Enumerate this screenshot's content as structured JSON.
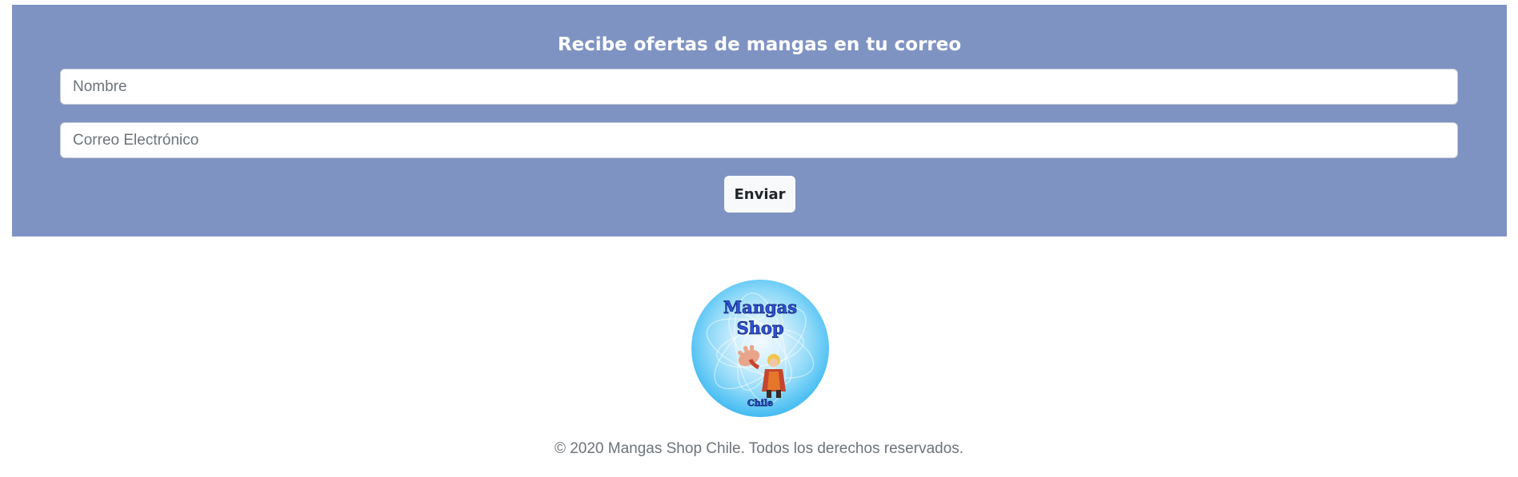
{
  "newsletter": {
    "title": "Recibe ofertas de mangas en tu correo",
    "name_placeholder": "Nombre",
    "email_placeholder": "Correo Electrónico",
    "submit_label": "Enviar",
    "background_color": "#7f93c3"
  },
  "footer": {
    "logo": {
      "line1": "Mangas",
      "line2": "Shop",
      "line3": "Chile"
    },
    "copyright": "© 2020 Mangas Shop Chile. Todos los derechos reservados."
  }
}
